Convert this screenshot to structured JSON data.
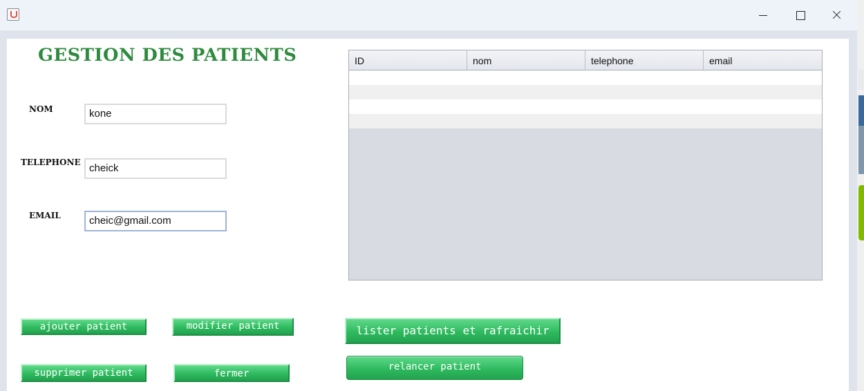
{
  "window": {
    "title": ""
  },
  "form": {
    "title": "GESTION DES PATIENTS",
    "fields": {
      "nom": {
        "label": "NOM",
        "value": "kone"
      },
      "telephone": {
        "label": "TELEPHONE",
        "value": "cheick"
      },
      "email": {
        "label": "EMAIL",
        "value": "cheic@gmail.com"
      }
    }
  },
  "table": {
    "columns": [
      "ID",
      "nom",
      "telephone",
      "email"
    ],
    "rows": []
  },
  "buttons": {
    "ajouter": "ajouter patient",
    "modifier": "modifier patient",
    "supprimer": "supprimer patient",
    "fermer": "fermer",
    "lister": "lister patients et rafraichir",
    "relancer": "relancer patient"
  },
  "colors": {
    "title": "#2e8b3e",
    "button": "#2fba5f",
    "table_empty": "#d8dbe2"
  },
  "icons": [
    "java-app-icon",
    "minimize-icon",
    "maximize-icon",
    "close-icon"
  ]
}
